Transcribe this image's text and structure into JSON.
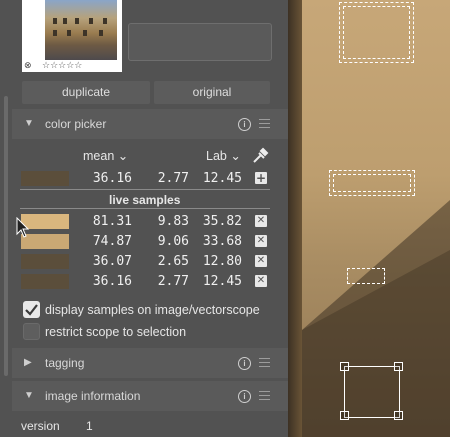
{
  "thumbnail": {
    "reject_icon": "⊗",
    "stars": "☆☆☆☆☆"
  },
  "buttons": {
    "duplicate": "duplicate",
    "original": "original"
  },
  "color_picker": {
    "title": "color picker",
    "mode_label": "mean ⌄",
    "space_label": "Lab ⌄",
    "main_sample": {
      "swatch": "#5b4e3b",
      "values": [
        "36.16",
        "2.77",
        "12.45"
      ]
    },
    "live_samples_label": "live samples",
    "samples": [
      {
        "swatch": "#d9b67e",
        "values": [
          "81.31",
          "9.83",
          "35.82"
        ]
      },
      {
        "swatch": "#caa874",
        "values": [
          "74.87",
          "9.06",
          "33.68"
        ]
      },
      {
        "swatch": "#5b4e3b",
        "values": [
          "36.07",
          "2.65",
          "12.80"
        ]
      },
      {
        "swatch": "#5b4e3b",
        "values": [
          "36.16",
          "2.77",
          "12.45"
        ]
      }
    ],
    "display_samples": {
      "label": "display samples on image/vectorscope",
      "checked": true
    },
    "restrict_scope": {
      "label": "restrict scope to selection",
      "checked": false
    }
  },
  "tagging": {
    "title": "tagging"
  },
  "image_information": {
    "title": "image information",
    "version_label": "version",
    "version_value": "1"
  },
  "colors": {
    "panel": "#525252",
    "accent_check": "#e8e8e8"
  }
}
